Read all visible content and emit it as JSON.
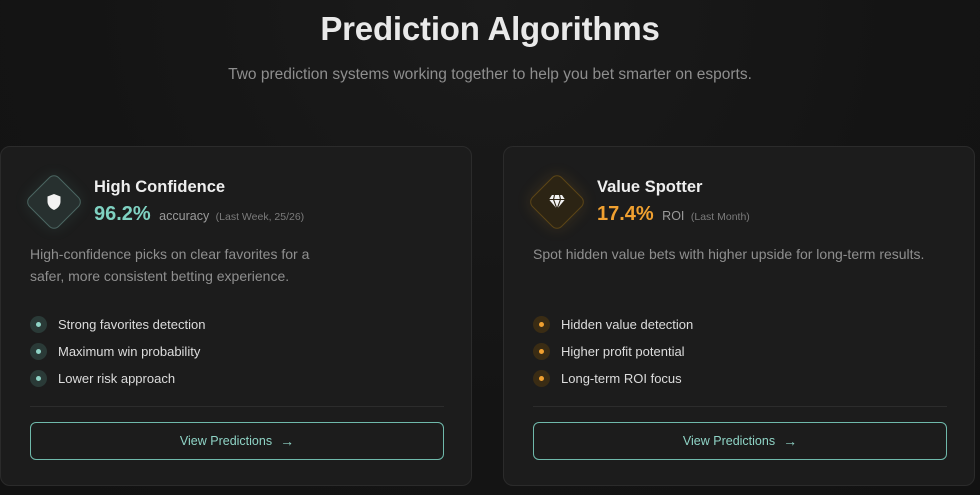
{
  "header": {
    "title": "Prediction Algorithms",
    "subtitle": "Two prediction systems working together to help you bet smarter on esports."
  },
  "cards": [
    {
      "title": "High Confidence",
      "icon": "shield-icon",
      "accent_color": "#7fd1c1",
      "metric_value": "96.2%",
      "metric_label": "accuracy",
      "metric_note": "(Last Week, 25/26)",
      "description": "High-confidence picks on clear favorites for a safer, more consistent betting experience.",
      "features": [
        "Strong favorites detection",
        "Maximum win probability",
        "Lower risk approach"
      ],
      "button_label": "View Predictions",
      "button_arrow": "→"
    },
    {
      "title": "Value Spotter",
      "icon": "gem-icon",
      "accent_color": "#f0a030",
      "metric_value": "17.4%",
      "metric_label": "ROI",
      "metric_note": "(Last Month)",
      "description": "Spot hidden value bets with higher upside for long-term results.",
      "features": [
        "Hidden value detection",
        "Higher profit potential",
        "Long-term ROI focus"
      ],
      "button_label": "View Predictions",
      "button_arrow": "→"
    }
  ]
}
